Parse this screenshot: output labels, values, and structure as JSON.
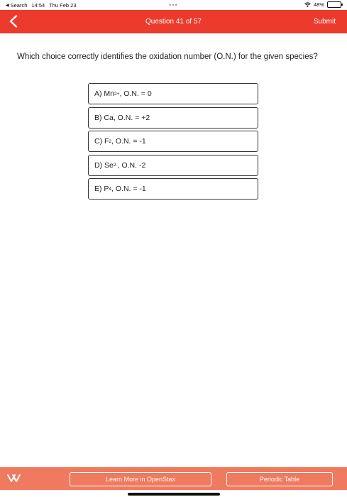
{
  "status_bar": {
    "back_app": "Search",
    "time": "14:54",
    "date": "Thu Feb 23",
    "battery": "48%",
    "battery_level": 0.48
  },
  "header": {
    "title": "Question 41 of 57",
    "submit_label": "Submit",
    "background_color": "#ec3b2d"
  },
  "question": {
    "prompt": "Which choice correctly identifies the oxidation number (O.N.) for the given species?"
  },
  "answers": [
    {
      "pre": "A) Mn",
      "sup": "2+",
      "sub": "",
      "post": ", O.N. = 0"
    },
    {
      "pre": "B) Ca, O.N. = +2",
      "sup": "",
      "sub": "",
      "post": ""
    },
    {
      "pre": "C) F",
      "sup": "",
      "sub": "2",
      "post": ", O.N. = -1"
    },
    {
      "pre": "D) Se",
      "sup": "2-",
      "sub": "",
      "post": ", O.N. -2"
    },
    {
      "pre": "E) P",
      "sup": "",
      "sub": "4",
      "post": ", O.N. = -1"
    }
  ],
  "footer": {
    "openstax_label": "Learn More in OpenStax",
    "periodic_label": "Periodic Table",
    "background_color": "#ef7a5f"
  },
  "icons": {
    "back": "chevron-left-icon",
    "collapse": "double-chevron-icon",
    "wifi": "wifi-icon",
    "battery": "battery-icon"
  }
}
